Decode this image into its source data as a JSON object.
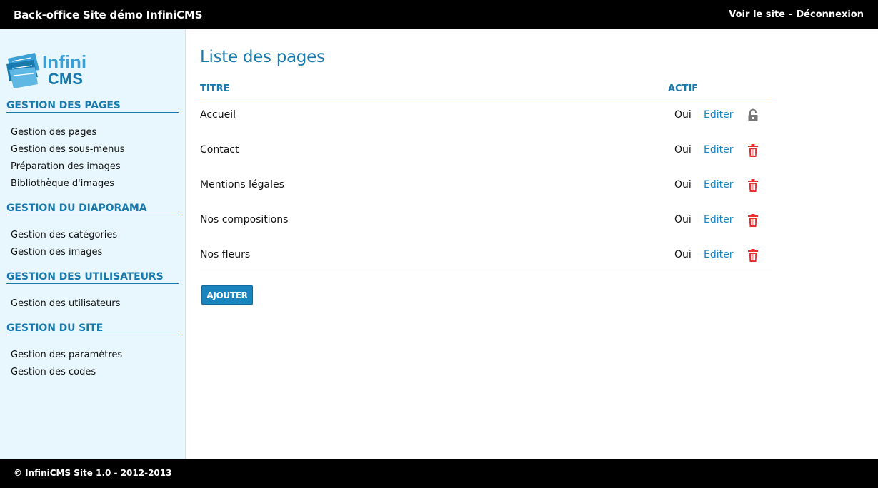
{
  "header": {
    "site_title": "Back-office Site démo InfiniCMS",
    "view_site": "Voir le site",
    "separator": "-",
    "logout": "Déconnexion"
  },
  "logo": {
    "text_top": "Infini",
    "text_bottom": "CMS"
  },
  "sidebar": {
    "sections": [
      {
        "title": "GESTION DES PAGES",
        "items": [
          "Gestion des pages",
          "Gestion des sous-menus",
          "Préparation des images",
          "Bibliothèque d'images"
        ]
      },
      {
        "title": "GESTION DU DIAPORAMA",
        "items": [
          "Gestion des catégories",
          "Gestion des images"
        ]
      },
      {
        "title": "GESTION DES UTILISATEURS",
        "items": [
          "Gestion des utilisateurs"
        ]
      },
      {
        "title": "GESTION DU SITE",
        "items": [
          "Gestion des paramètres",
          "Gestion des codes"
        ]
      }
    ]
  },
  "main": {
    "title": "Liste des pages",
    "columns": {
      "title": "TITRE",
      "active": "ACTIF"
    },
    "rows": [
      {
        "title": "Accueil",
        "active": "Oui",
        "edit": "Editer",
        "icon": "lock-icon"
      },
      {
        "title": "Contact",
        "active": "Oui",
        "edit": "Editer",
        "icon": "trash-icon"
      },
      {
        "title": "Mentions légales",
        "active": "Oui",
        "edit": "Editer",
        "icon": "trash-icon"
      },
      {
        "title": "Nos compositions",
        "active": "Oui",
        "edit": "Editer",
        "icon": "trash-icon"
      },
      {
        "title": "Nos fleurs",
        "active": "Oui",
        "edit": "Editer",
        "icon": "trash-icon"
      }
    ],
    "add_button": "AJOUTER"
  },
  "footer": {
    "text": "© InfiniCMS Site 1.0 - 2012-2013"
  },
  "colors": {
    "accent": "#1879ac",
    "link": "#1a84bf",
    "sidebar_bg": "#e8f6fd",
    "delete": "#e8302c",
    "lock": "#777777"
  }
}
